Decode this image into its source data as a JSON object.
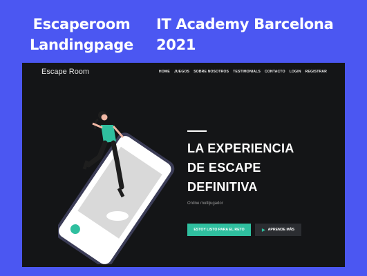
{
  "banner": {
    "left_title": "Escaperoom Landingpage",
    "right_title": "IT Academy Barcelona 2021"
  },
  "site": {
    "brand": "Escape Room",
    "nav": [
      "HOME",
      "JUEGOS",
      "SOBRE NOSOTROS",
      "TESTIMONIALS",
      "CONTACTO",
      "LOGIN",
      "REGISTRAR"
    ],
    "headline": [
      "LA EXPERIENCIA",
      "DE ESCAPE",
      "DEFINITIVA"
    ],
    "subtitle": "Online multijugador",
    "primary_button": "ESTOY LISTO PARA EL RETO",
    "secondary_button": "APRENDE MÁS",
    "colors": {
      "accent": "#2fbf9f",
      "background": "#141517",
      "frame": "#4b57f2"
    }
  }
}
